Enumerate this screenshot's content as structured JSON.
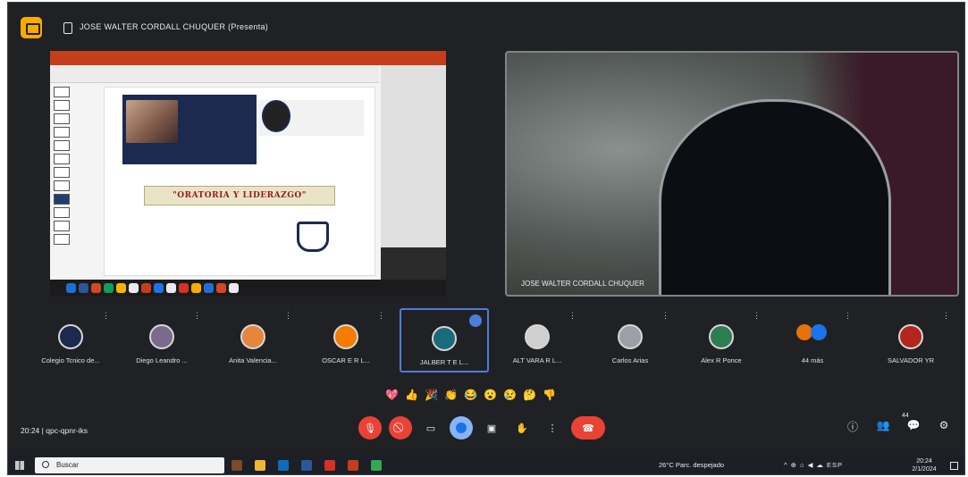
{
  "meeting": {
    "presenter_title": "JOSE WALTER CORDALL CHUQUER (Presenta)",
    "time": "20:24",
    "meeting_code": "qpc-qpnr-iks"
  },
  "shared_slide": {
    "title": "\"ORATORIA Y LIDERAZGO\""
  },
  "camera": {
    "name": "JOSE WALTER CORDALL CHUQUER"
  },
  "participants": [
    {
      "name": "Colegio Tcnico de...",
      "color": "#1b2a4e"
    },
    {
      "name": "Diego Leandro ...",
      "color": "#7a6a8c"
    },
    {
      "name": "Anita Valencia...",
      "color": "#e8853d"
    },
    {
      "name": "OSCAR E R L...",
      "color": "#f57c00"
    },
    {
      "name": "JALBER T E L...",
      "color": "#1a6b7a",
      "active": true
    },
    {
      "name": "ALT VARA R L...",
      "color": "#cfcfcf"
    },
    {
      "name": "Carlos Arias",
      "color": "#9aa0a6"
    },
    {
      "name": "Alex R Ponce",
      "color": "#2e7d52"
    },
    {
      "name": "44 más",
      "color": "#e8710a"
    },
    {
      "name": "SALVADOR YR",
      "color": "#b3261e"
    }
  ],
  "participant_more_icon": "more-vert-icon",
  "reactions": [
    "💖",
    "👍",
    "🎉",
    "👏",
    "😂",
    "😮",
    "😢",
    "🤔",
    "👎"
  ],
  "controls": [
    {
      "name": "mic-off-button",
      "icon": "mic-off-icon",
      "glyph": "🎙",
      "style": "red"
    },
    {
      "name": "camera-off-button",
      "icon": "videocam-off-icon",
      "glyph": "⃠",
      "style": "red"
    },
    {
      "name": "captions-button",
      "icon": "captions-icon",
      "glyph": "▭",
      "style": "plain"
    },
    {
      "name": "reactions-button",
      "icon": "emoji-icon",
      "glyph": "",
      "style": "blue"
    },
    {
      "name": "present-button",
      "icon": "present-icon",
      "glyph": "▣",
      "style": "plain"
    },
    {
      "name": "raise-hand-button",
      "icon": "hand-icon",
      "glyph": "✋",
      "style": "plain"
    },
    {
      "name": "more-options-button",
      "icon": "more-vert-icon",
      "glyph": "⋮",
      "style": "plain"
    },
    {
      "name": "end-call-button",
      "icon": "call-end-icon",
      "glyph": "☎",
      "style": "end"
    }
  ],
  "right_controls": [
    {
      "name": "meeting-info-button",
      "icon": "info-icon",
      "glyph": "ⓘ"
    },
    {
      "name": "people-button",
      "icon": "people-icon",
      "glyph": "👥"
    },
    {
      "name": "chat-button",
      "icon": "chat-icon",
      "glyph": "💬"
    },
    {
      "name": "activities-button",
      "icon": "shapes-icon",
      "glyph": "⚙"
    }
  ],
  "people_count": "44",
  "taskbar": {
    "search_placeholder": "Buscar",
    "weather": "26°C  Parc. despejado",
    "tray": "^ ⊕ ⌂ ◀ ☁ ESP",
    "time": "20:24",
    "date": "2/1/2024"
  },
  "colors": {
    "meet_bg": "#202124",
    "accent_blue": "#4f7cd9",
    "danger_red": "#ea4335",
    "logo_yellow": "#f9ab00"
  }
}
